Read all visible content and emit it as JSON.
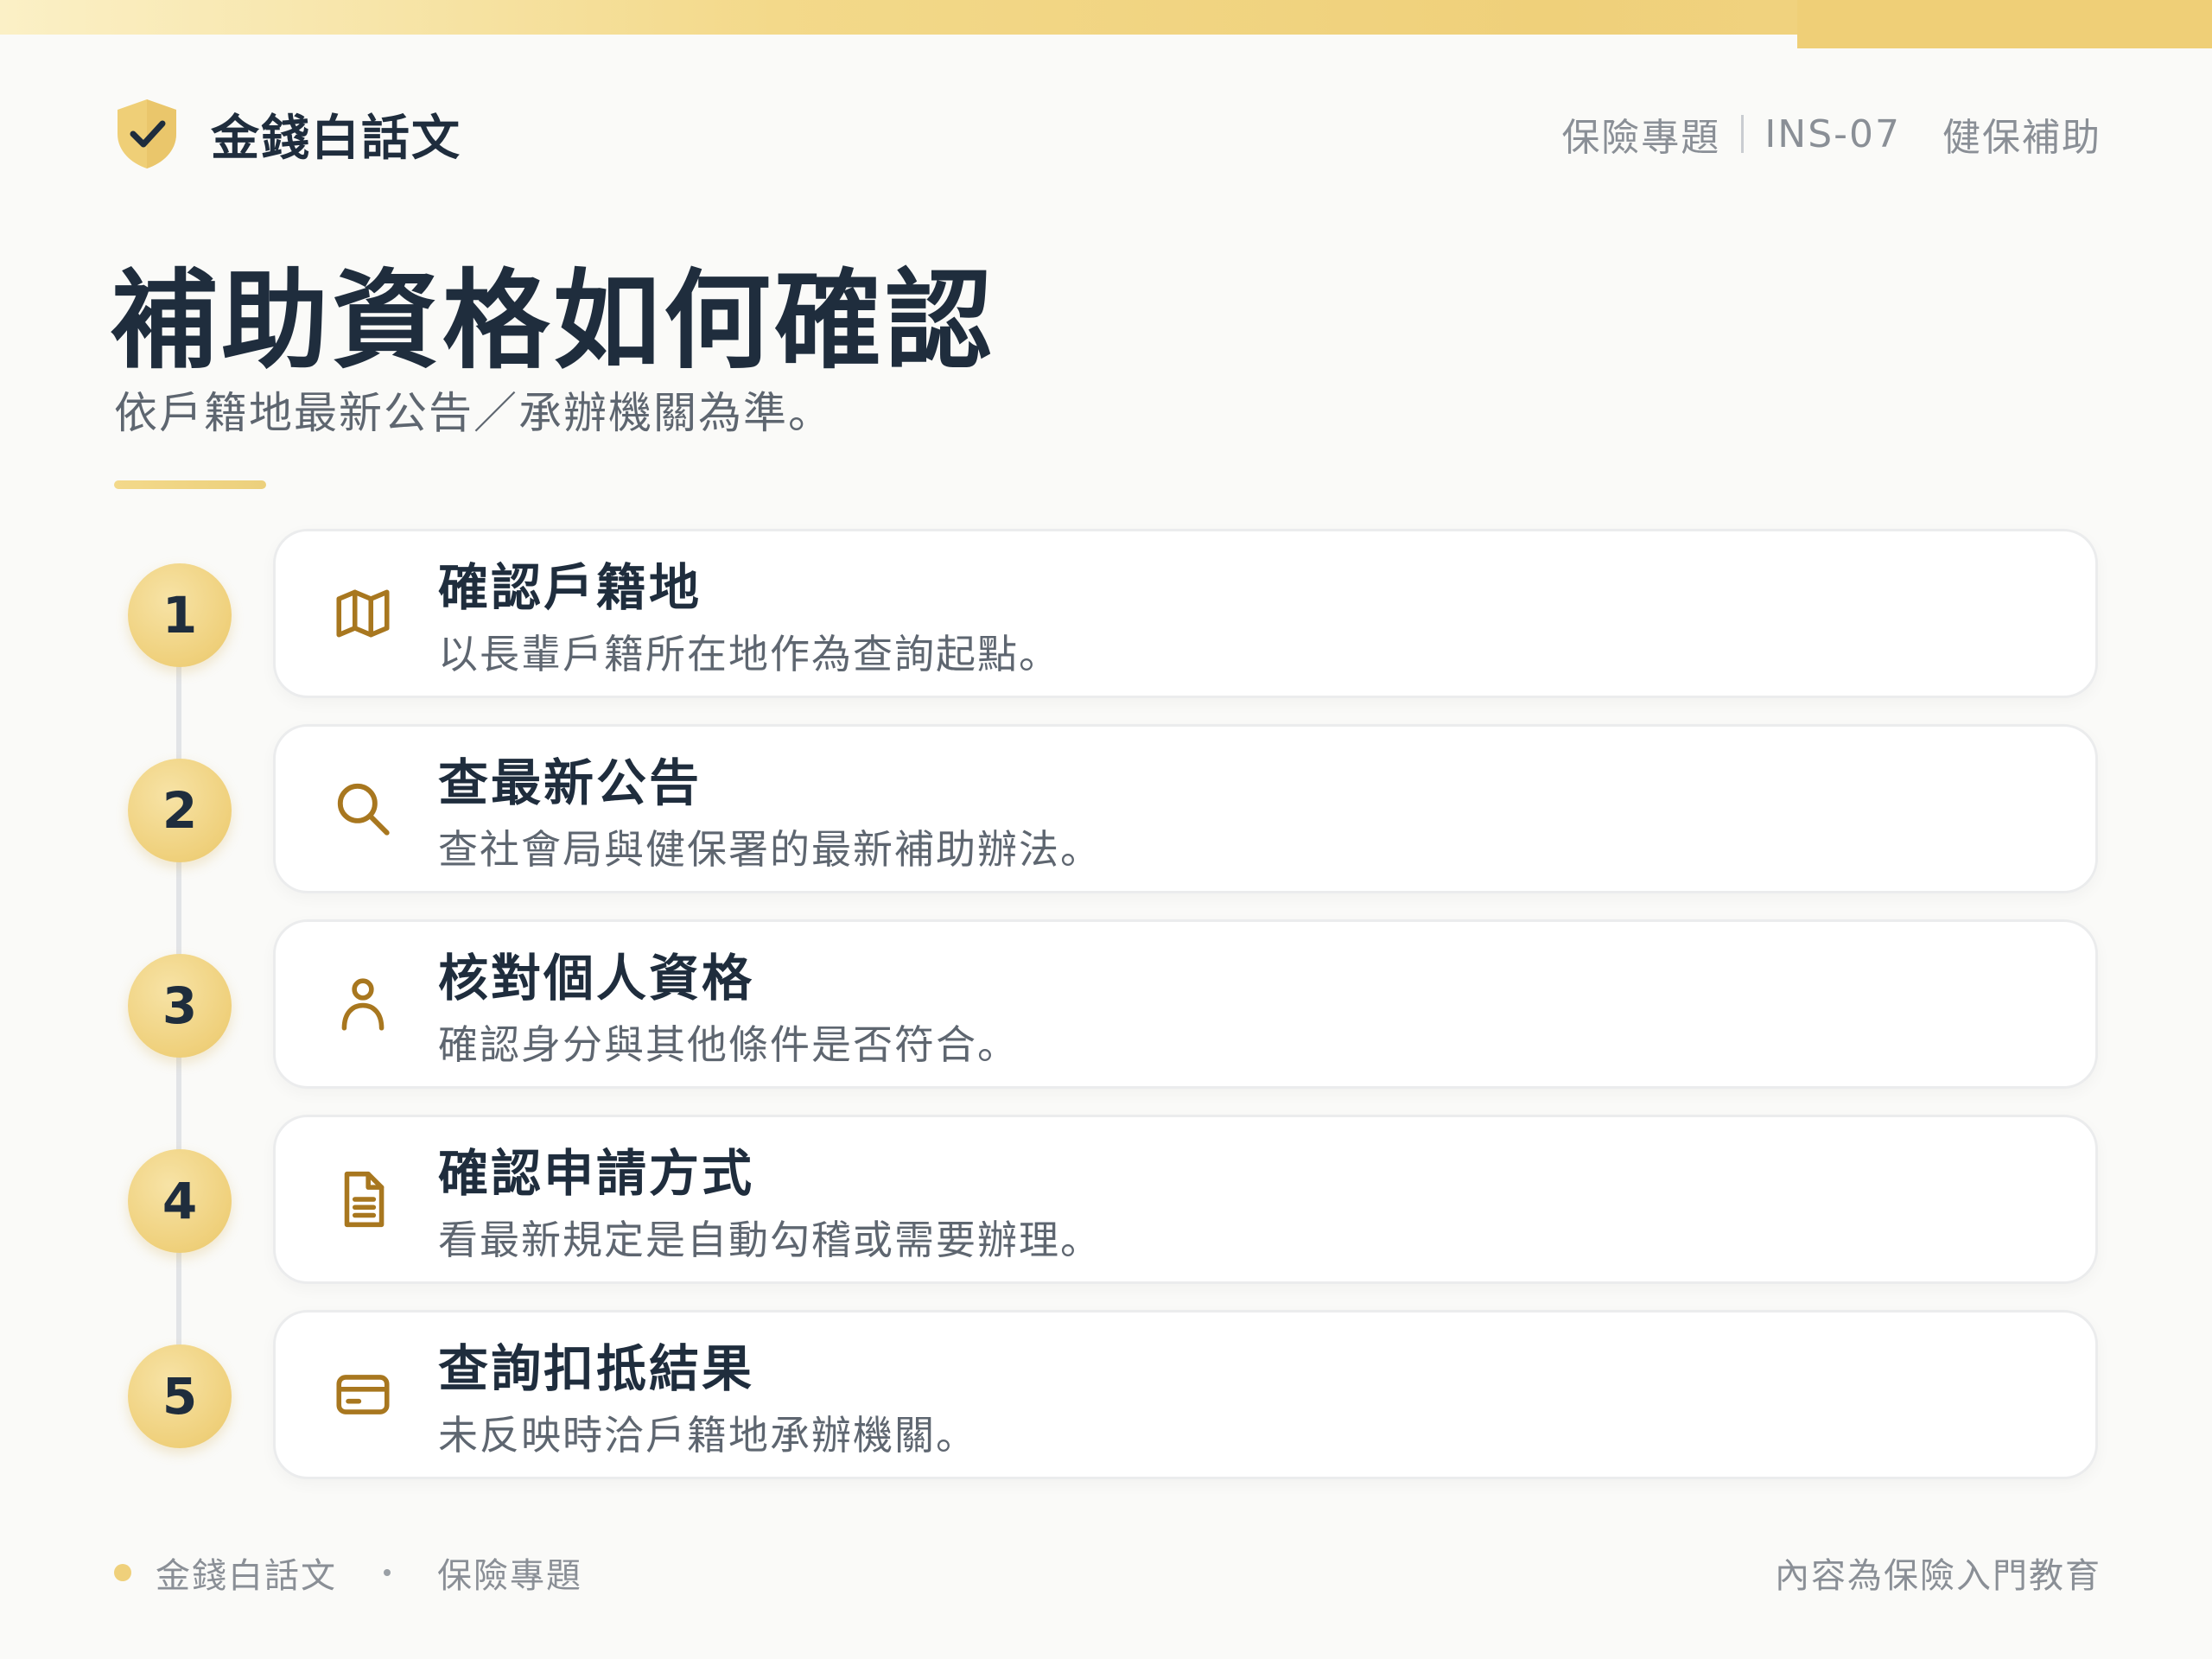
{
  "brand": {
    "name": "金錢白話文",
    "icon": "shield-check-icon"
  },
  "header_meta": {
    "category": "保險專題",
    "code": "INS-07",
    "topic": "健保補助"
  },
  "title": "補助資格如何確認",
  "subtitle": "依戶籍地最新公告／承辦機關為準。",
  "colors": {
    "accent": "#efd07b",
    "icon_gold": "#a8771f",
    "text_dark": "#1f2d3d",
    "text_muted": "#5e6670"
  },
  "steps": [
    {
      "number": "1",
      "icon": "map-icon",
      "title": "確認戶籍地",
      "description": "以長輩戶籍所在地作為查詢起點。"
    },
    {
      "number": "2",
      "icon": "search-icon",
      "title": "查最新公告",
      "description": "查社會局與健保署的最新補助辦法。"
    },
    {
      "number": "3",
      "icon": "user-icon",
      "title": "核對個人資格",
      "description": "確認身分與其他條件是否符合。"
    },
    {
      "number": "4",
      "icon": "document-icon",
      "title": "確認申請方式",
      "description": "看最新規定是自動勾稽或需要辦理。"
    },
    {
      "number": "5",
      "icon": "card-icon",
      "title": "查詢扣抵結果",
      "description": "未反映時洽戶籍地承辦機關。"
    }
  ],
  "footer": {
    "brand": "金錢白話文",
    "category": "保險專題",
    "disclaimer": "內容為保險入門教育"
  }
}
